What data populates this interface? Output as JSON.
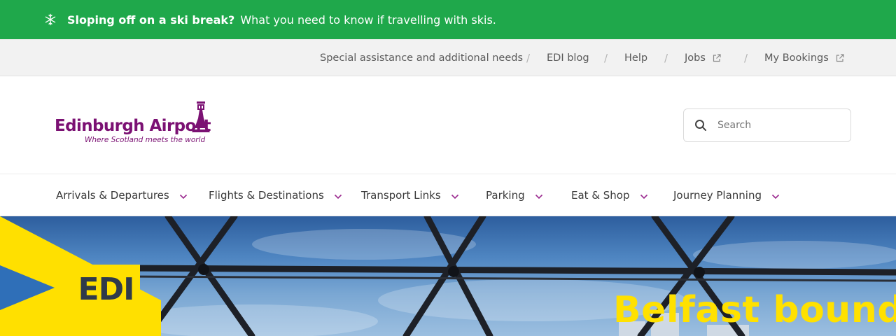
{
  "alert": {
    "icon": "snowflake-icon",
    "title": "Sloping off on a ski break?",
    "text": "What you need to know if travelling with skis."
  },
  "utility": {
    "links": [
      {
        "label": "Special assistance and additional needs",
        "external": false
      },
      {
        "label": "EDI blog",
        "external": false
      },
      {
        "label": "Help",
        "external": false
      },
      {
        "label": "Jobs",
        "external": true
      },
      {
        "label": "My Bookings",
        "external": true
      }
    ],
    "separator": "/"
  },
  "header": {
    "logo_name": "Edinburgh Airport",
    "logo_tagline": "Where Scotland meets the world",
    "search_placeholder": "Search"
  },
  "nav": {
    "items": [
      {
        "label": "Arrivals & Departures"
      },
      {
        "label": "Flights & Destinations"
      },
      {
        "label": "Transport Links"
      },
      {
        "label": "Parking"
      },
      {
        "label": "Eat & Shop"
      },
      {
        "label": "Journey Planning"
      }
    ]
  },
  "hero": {
    "badge": "EDI",
    "title": "Belfast bound"
  },
  "colors": {
    "alert_bg": "#1fa84b",
    "brand_purple": "#7b1173",
    "accent_yellow": "#ffe000",
    "chevron": "#9b2a8f"
  }
}
